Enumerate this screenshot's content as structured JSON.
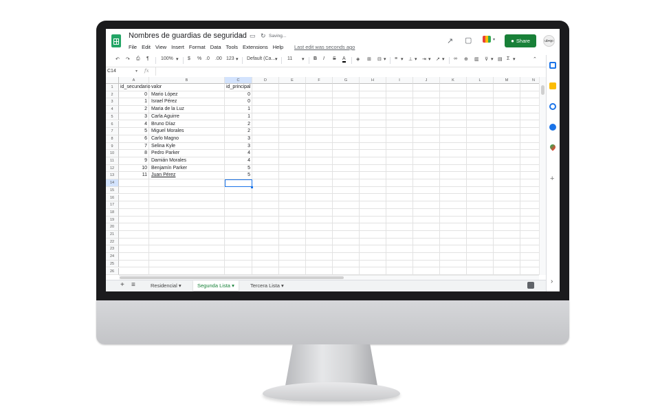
{
  "app": {
    "doc_title": "Nombres de guardias de seguridad",
    "saving_status": "Saving...",
    "menu": [
      "File",
      "Edit",
      "View",
      "Insert",
      "Format",
      "Data",
      "Tools",
      "Extensions",
      "Help"
    ],
    "last_edit": "Last edit was seconds ago",
    "share_label": "Share",
    "avatar_text": "ub•qo"
  },
  "toolbar": {
    "zoom": "100%",
    "currency": "$",
    "percent": "%",
    "dec_less": ".0",
    "dec_more": ".00",
    "number_format": "123",
    "font": "Default (Ca...",
    "font_size": "11",
    "bold": "B",
    "italic": "I",
    "strike": "S",
    "text_color": "A"
  },
  "formula_bar": {
    "name_box": "C14",
    "fx": "fx"
  },
  "grid": {
    "columns": [
      "A",
      "B",
      "C",
      "D",
      "E",
      "F",
      "G",
      "H",
      "I",
      "J",
      "K",
      "L",
      "M",
      "N"
    ],
    "rows": [
      "1",
      "2",
      "3",
      "4",
      "5",
      "6",
      "7",
      "8",
      "9",
      "10",
      "11",
      "12",
      "13",
      "14",
      "15",
      "16",
      "17",
      "18",
      "19",
      "20",
      "21",
      "22",
      "23",
      "24",
      "25",
      "26"
    ],
    "header": {
      "a": "id_secundario",
      "b": "valor",
      "c": "id_principal"
    },
    "data": [
      {
        "a": "0",
        "b": "Mario López",
        "c": "0"
      },
      {
        "a": "1",
        "b": "Israel Pérez",
        "c": "0"
      },
      {
        "a": "2",
        "b": "Maria de la Luz",
        "c": "1"
      },
      {
        "a": "3",
        "b": "Carla Aguirre",
        "c": "1"
      },
      {
        "a": "4",
        "b": "Bruno Díaz",
        "c": "2"
      },
      {
        "a": "5",
        "b": "Miguel Morales",
        "c": "2"
      },
      {
        "a": "6",
        "b": "Carlo Magno",
        "c": "3"
      },
      {
        "a": "7",
        "b": "Selina Kyle",
        "c": "3"
      },
      {
        "a": "8",
        "b": "Pedro Parker",
        "c": "4"
      },
      {
        "a": "9",
        "b": "Damián Morales",
        "c": "4"
      },
      {
        "a": "10",
        "b": "Benjamín Parker",
        "c": "5"
      },
      {
        "a": "11",
        "b": "Juan Pérez",
        "c": "5"
      }
    ]
  },
  "sheets": {
    "add": "+",
    "list": "≡",
    "tabs": [
      "Residencial",
      "Segunda Lista",
      "Tercera Lista"
    ],
    "active": "Segunda Lista"
  },
  "side_panel": {
    "add": "+",
    "expand": "›"
  },
  "colors": {
    "accent": "#188038",
    "selection": "#1a73e8"
  }
}
